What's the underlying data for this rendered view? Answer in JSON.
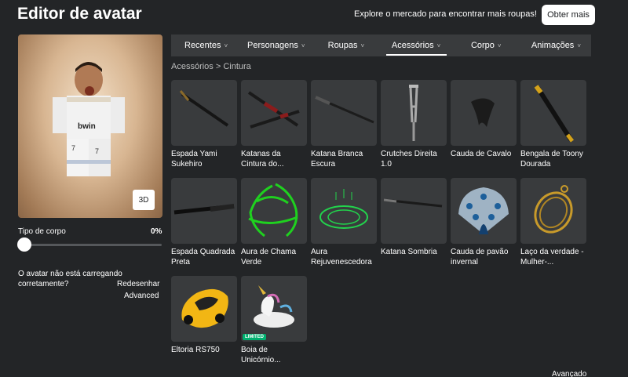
{
  "header": {
    "title": "Editor de avatar",
    "promo": "Explore o mercado para encontrar mais roupas!",
    "get_more": "Obter mais"
  },
  "preview": {
    "btn_3d": "3D",
    "body_type_label": "Tipo de corpo",
    "body_type_value": "0%",
    "body_type_level": 0
  },
  "issue": {
    "text": "O avatar não está carregando corretamente?",
    "redraw": "Redesenhar",
    "advanced": "Advanced"
  },
  "tabs": [
    {
      "label": "Recentes",
      "chev": "˅"
    },
    {
      "label": "Personagens",
      "chev": "˅"
    },
    {
      "label": "Roupas",
      "chev": "˅"
    },
    {
      "label": "Acessórios",
      "chev": "˅"
    },
    {
      "label": "Corpo",
      "chev": "˅"
    },
    {
      "label": "Animações",
      "chev": "˅"
    }
  ],
  "breadcrumb": "Acessórios > Cintura",
  "items": [
    {
      "name": "Espada Yami Sukehiro"
    },
    {
      "name": "Katanas da Cintura do..."
    },
    {
      "name": "Katana Branca Escura"
    },
    {
      "name": "Crutches Direita 1.0"
    },
    {
      "name": "Cauda de Cavalo"
    },
    {
      "name": "Bengala de Toony Dourada"
    },
    {
      "name": "Espada Quadrada Preta"
    },
    {
      "name": "Aura de Chama Verde"
    },
    {
      "name": "Aura Rejuvenescedora"
    },
    {
      "name": "Katana Sombria"
    },
    {
      "name": "Cauda de pavão invernal"
    },
    {
      "name": "Laço da verdade - Mulher-..."
    },
    {
      "name": "Eltoria RS750"
    },
    {
      "name": "Boia de Unicórnio...",
      "badge": "LIMITED"
    }
  ],
  "bottom": {
    "advanced": "Avançado"
  }
}
